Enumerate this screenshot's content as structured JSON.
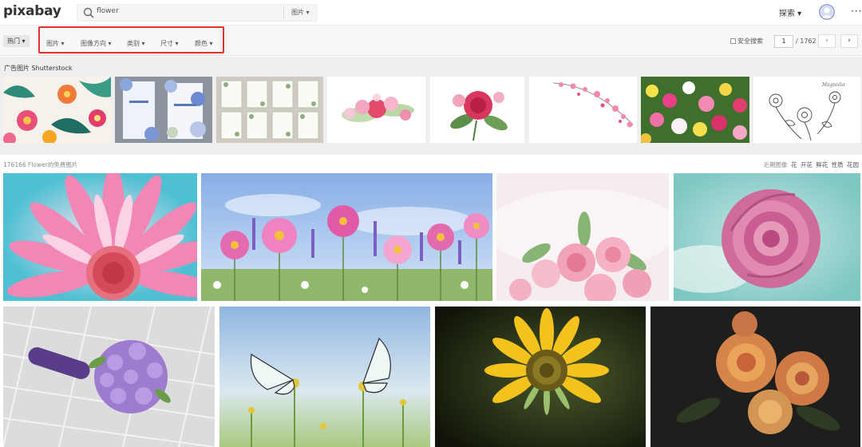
{
  "header": {
    "logo": "pixabay",
    "search_value": "flower",
    "search_type": "图片 ▾",
    "explore": "探索 ▾",
    "more": "···"
  },
  "filterbar": {
    "hot": "热门 ▾",
    "filters": [
      "图片 ▾",
      "图像方向 ▾",
      "类别 ▾",
      "尺寸 ▾",
      "颜色 ▾"
    ],
    "safe_search": "安全搜索",
    "page_current": "1",
    "page_total": "/ 1762",
    "prev": "‹",
    "next": "›"
  },
  "sponsored": {
    "title": "广告图片 Shutterstock"
  },
  "results": {
    "count": "176166 Flower的免费图片",
    "related_label": "近期图像",
    "related_tags": [
      "花",
      "开花",
      "鲜花",
      "性质",
      "花园"
    ]
  },
  "colors": {
    "highlight_border": "#e23131",
    "filter_bg": "#f7f7f7",
    "sponsor_bg": "#efefef"
  }
}
